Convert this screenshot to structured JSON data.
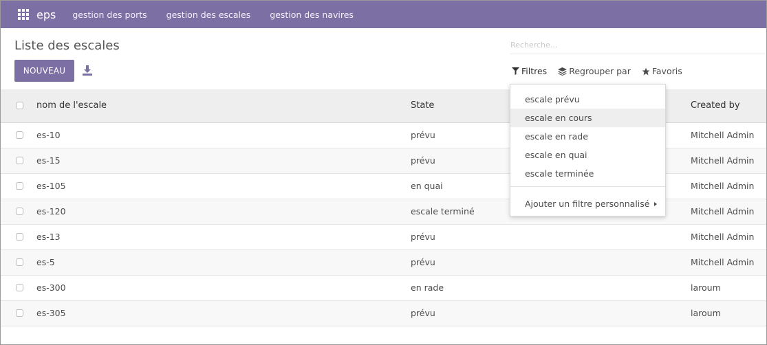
{
  "navbar": {
    "brand": "eps",
    "menu": [
      "gestion des ports",
      "gestion des escales",
      "gestion des navires"
    ]
  },
  "page": {
    "title": "Liste des escales",
    "new_button": "NOUVEAU",
    "search_placeholder": "Recherche..."
  },
  "search_tools": {
    "filters": "Filtres",
    "group_by": "Regrouper par",
    "favorites": "Favoris"
  },
  "filter_menu": {
    "items": [
      "escale prévu",
      "escale en cours",
      "escale en rade",
      "escale en quai",
      "escale terminée"
    ],
    "hovered": "escale en cours",
    "custom": "Ajouter un filtre personnalisé"
  },
  "table": {
    "columns": [
      "nom de l'escale",
      "State",
      "Created by"
    ],
    "rows": [
      {
        "name": "es-10",
        "state": "prévu",
        "created_by": "Mitchell Admin"
      },
      {
        "name": "es-15",
        "state": "prévu",
        "created_by": "Mitchell Admin"
      },
      {
        "name": "es-105",
        "state": "en quai",
        "created_by": "Mitchell Admin"
      },
      {
        "name": "es-120",
        "state": "escale terminé",
        "created_by": "Mitchell Admin"
      },
      {
        "name": "es-13",
        "state": "prévu",
        "created_by": "Mitchell Admin"
      },
      {
        "name": "es-5",
        "state": "prévu",
        "created_by": "Mitchell Admin"
      },
      {
        "name": "es-300",
        "state": "en rade",
        "created_by": "laroum"
      },
      {
        "name": "es-305",
        "state": "prévu",
        "created_by": "laroum"
      }
    ]
  },
  "colors": {
    "brand": "#7c6fa3",
    "header_bg": "#eeeeee"
  }
}
